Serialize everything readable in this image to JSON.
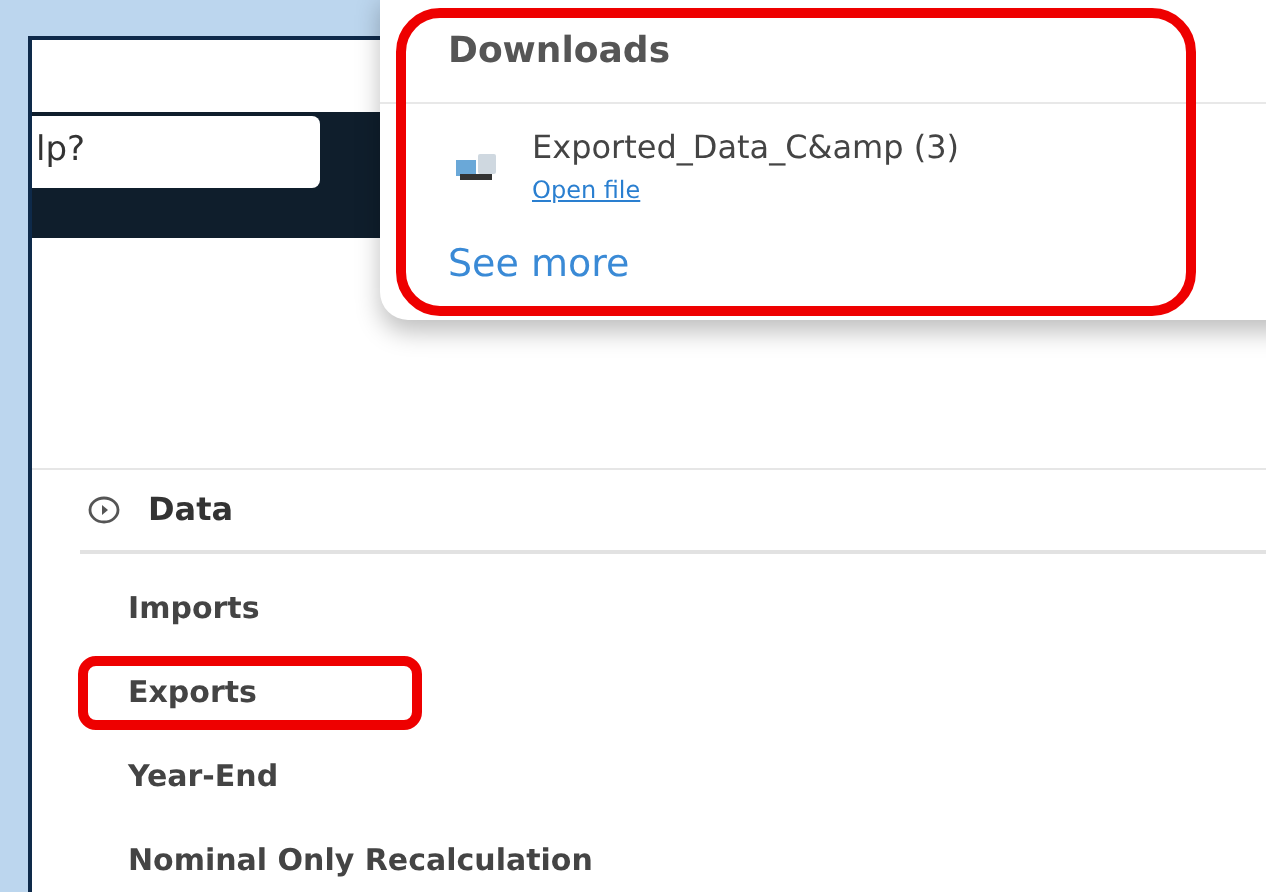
{
  "search": {
    "value": "lp?"
  },
  "downloads": {
    "title": "Downloads",
    "highlighted": true,
    "items": [
      {
        "name": "Exported_Data_C&amp (3)",
        "action": "Open file"
      }
    ],
    "see_more": "See more"
  },
  "section": {
    "title": "Data",
    "items": [
      {
        "label": "Imports",
        "highlighted": false
      },
      {
        "label": "Exports",
        "highlighted": true
      },
      {
        "label": "Year-End",
        "highlighted": false
      },
      {
        "label": "Nominal Only Recalculation",
        "highlighted": false
      }
    ]
  }
}
